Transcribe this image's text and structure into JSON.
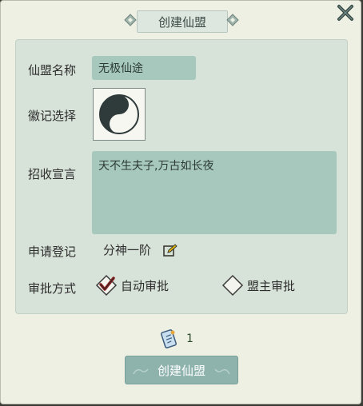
{
  "dialog": {
    "title": "创建仙盟"
  },
  "form": {
    "name_label": "仙盟名称",
    "name_value": "无极仙途",
    "emblem_label": "徽记选择",
    "emblem_icon": "yin-yang-icon",
    "declaration_label": "招收宣言",
    "declaration_value": "天不生夫子,万古如长夜",
    "registration_label": "申请登记",
    "registration_value": "分神一阶",
    "approval_label": "审批方式",
    "approval_options": [
      {
        "label": "自动审批",
        "checked": true
      },
      {
        "label": "盟主审批",
        "checked": false
      }
    ]
  },
  "cost": {
    "icon": "token-icon",
    "count": "1"
  },
  "actions": {
    "create_label": "创建仙盟"
  },
  "colors": {
    "field_bg": "#a7c9bd",
    "panel_bg": "#d7e2d9",
    "button_bg": "#8eb3ad",
    "check_red": "#8b1e1e"
  }
}
